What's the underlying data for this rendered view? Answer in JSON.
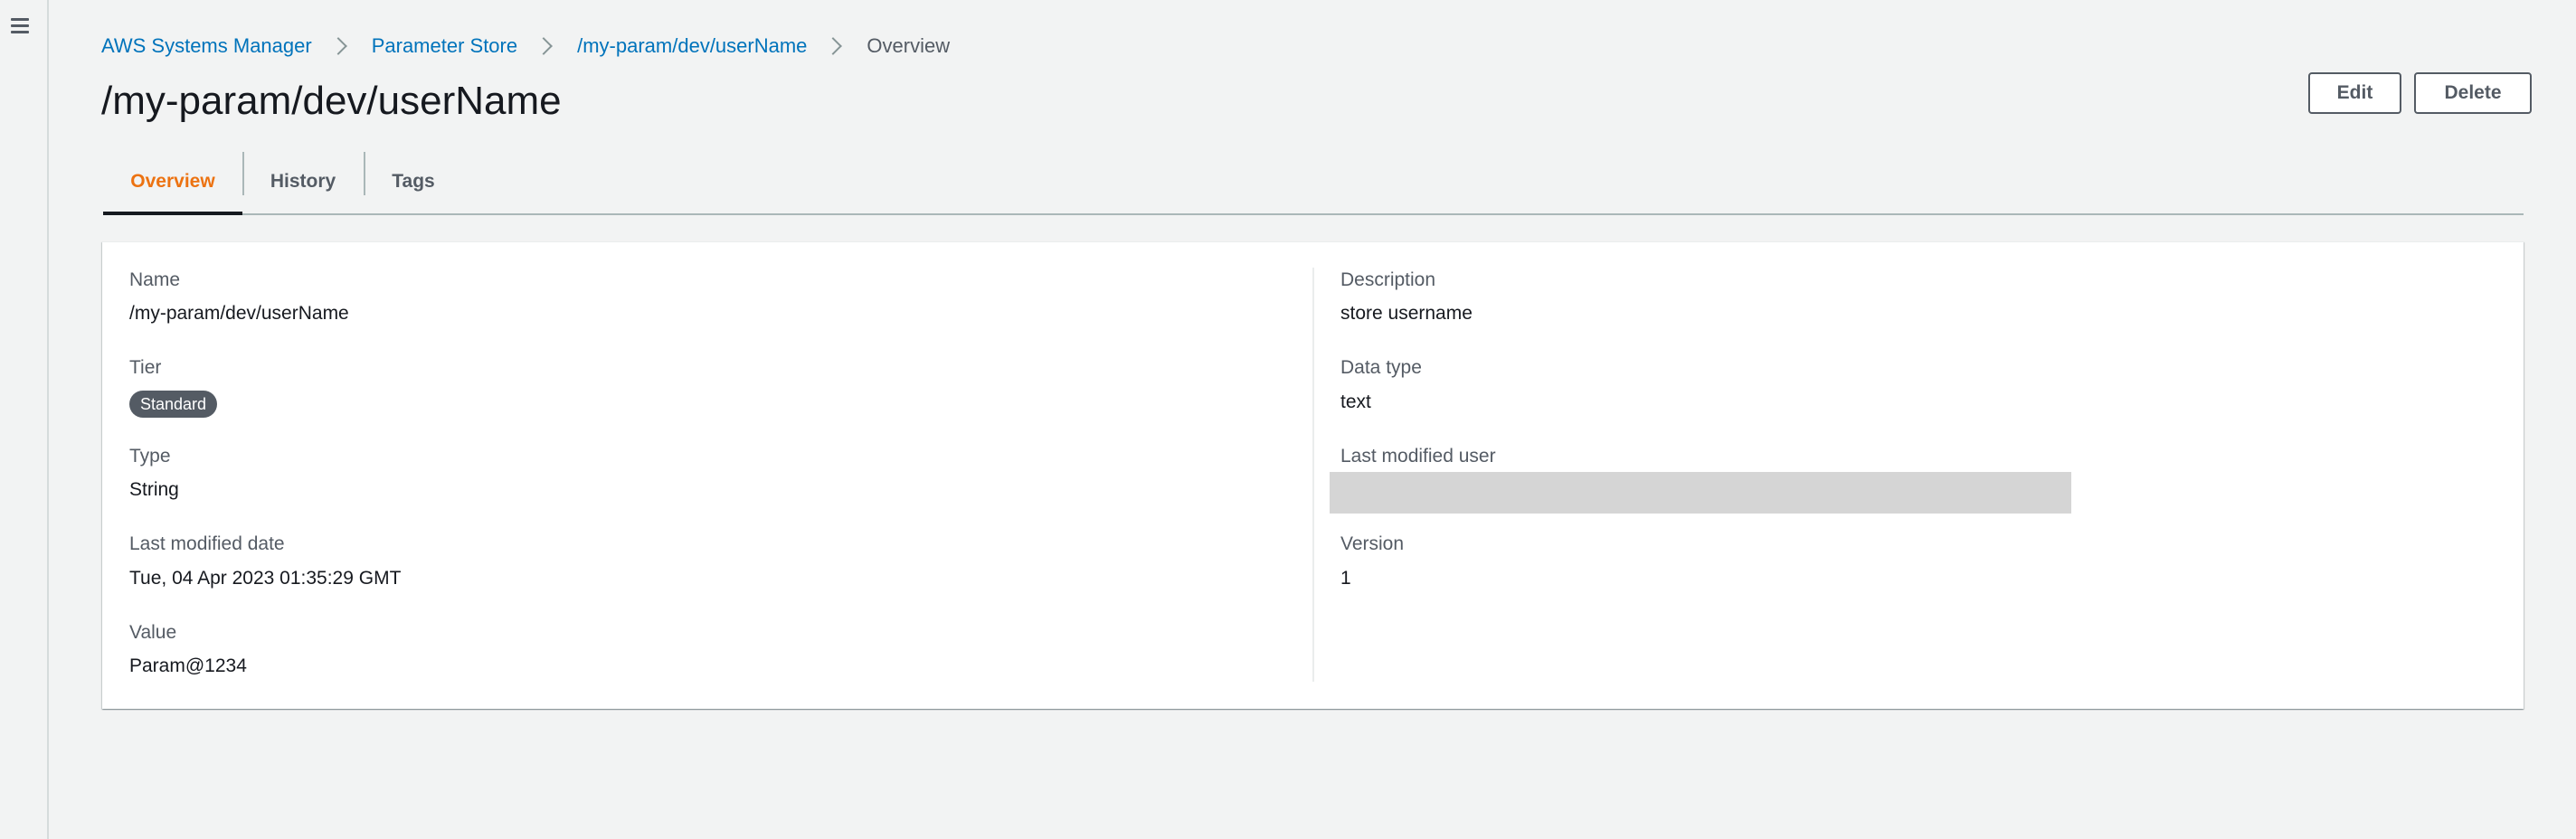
{
  "breadcrumb": {
    "items": [
      "AWS Systems Manager",
      "Parameter Store",
      "/my-param/dev/userName",
      "Overview"
    ]
  },
  "header": {
    "title": "/my-param/dev/userName",
    "edit_label": "Edit",
    "delete_label": "Delete"
  },
  "tabs": [
    {
      "label": "Overview",
      "active": true
    },
    {
      "label": "History",
      "active": false
    },
    {
      "label": "Tags",
      "active": false
    }
  ],
  "details": {
    "name": {
      "label": "Name",
      "value": "/my-param/dev/userName"
    },
    "tier": {
      "label": "Tier",
      "value": "Standard"
    },
    "type": {
      "label": "Type",
      "value": "String"
    },
    "last_modified_date": {
      "label": "Last modified date",
      "value": "Tue, 04 Apr 2023 01:35:29 GMT"
    },
    "value": {
      "label": "Value",
      "value": "Param@1234"
    },
    "description": {
      "label": "Description",
      "value": "store username"
    },
    "data_type": {
      "label": "Data type",
      "value": "text"
    },
    "last_modified_user": {
      "label": "Last modified user",
      "value": ""
    },
    "version": {
      "label": "Version",
      "value": "1"
    }
  },
  "colors": {
    "link": "#0073bb",
    "active_tab": "#ec7211",
    "badge_bg": "#545b64",
    "page_bg": "#f2f3f3"
  },
  "icons": {
    "menu": "hamburger-menu-icon",
    "breadcrumb_separator": "chevron-right-icon"
  }
}
